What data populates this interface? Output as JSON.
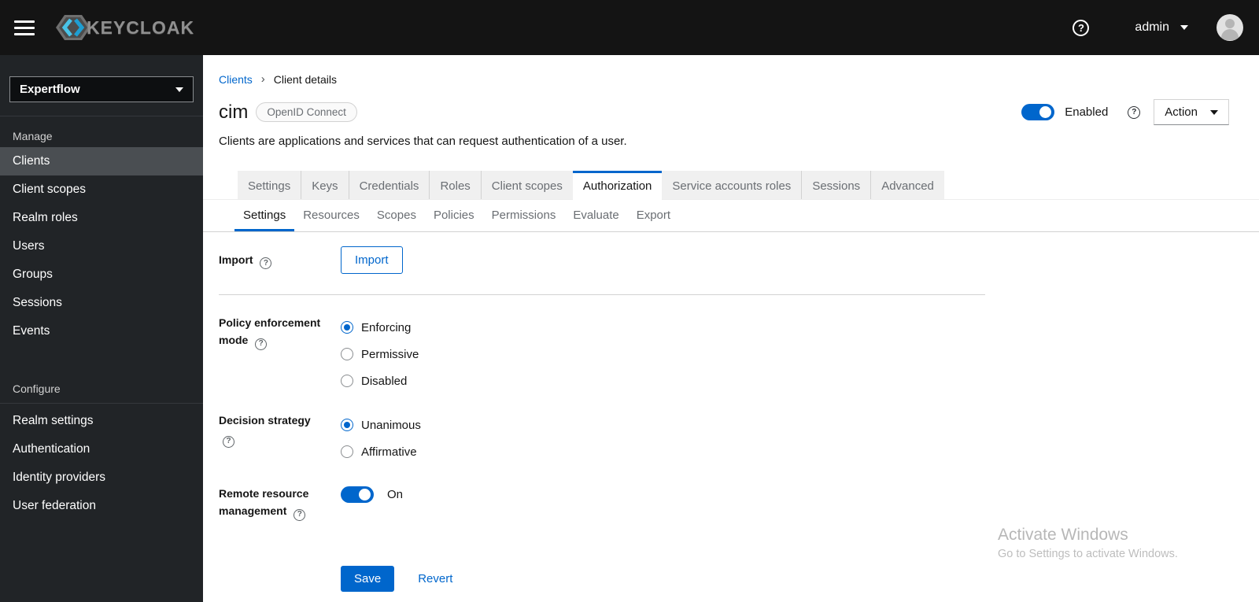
{
  "masthead": {
    "brand": "KEYCLOAK",
    "username": "admin"
  },
  "icons": {
    "help": "?",
    "breadcrumb_separator": "›"
  },
  "sidebar": {
    "realm_selector": {
      "value": "Expertflow"
    },
    "groups": [
      {
        "title": "Manage",
        "items": [
          {
            "label": "Clients",
            "active": true
          },
          {
            "label": "Client scopes",
            "active": false
          },
          {
            "label": "Realm roles",
            "active": false
          },
          {
            "label": "Users",
            "active": false
          },
          {
            "label": "Groups",
            "active": false
          },
          {
            "label": "Sessions",
            "active": false
          },
          {
            "label": "Events",
            "active": false
          }
        ]
      },
      {
        "title": "Configure",
        "items": [
          {
            "label": "Realm settings",
            "active": false
          },
          {
            "label": "Authentication",
            "active": false
          },
          {
            "label": "Identity providers",
            "active": false
          },
          {
            "label": "User federation",
            "active": false
          }
        ]
      }
    ]
  },
  "header": {
    "breadcrumb": [
      "Clients",
      "Client details"
    ],
    "title": "cim",
    "badge": "OpenID Connect",
    "description": "Clients are applications and services that can request authentication of a user.",
    "enabled_label": "Enabled",
    "action_label": "Action"
  },
  "tabs": {
    "items": [
      "Settings",
      "Keys",
      "Credentials",
      "Roles",
      "Client scopes",
      "Authorization",
      "Service accounts roles",
      "Sessions",
      "Advanced"
    ],
    "active": "Authorization"
  },
  "subtabs": {
    "items": [
      "Settings",
      "Resources",
      "Scopes",
      "Policies",
      "Permissions",
      "Evaluate",
      "Export"
    ],
    "active": "Settings"
  },
  "form": {
    "import": {
      "label": "Import",
      "button_label": "Import"
    },
    "policy_enforcement_mode": {
      "label_line1": "Policy enforcement",
      "label_line2": "mode",
      "options": [
        "Enforcing",
        "Permissive",
        "Disabled"
      ],
      "selected": "Enforcing"
    },
    "decision_strategy": {
      "label": "Decision strategy",
      "options": [
        "Unanimous",
        "Affirmative"
      ],
      "selected": "Unanimous"
    },
    "remote_resource_management": {
      "label_line1": "Remote resource",
      "label_line2": "management",
      "state_label": "On",
      "enabled": true
    },
    "save_label": "Save",
    "revert_label": "Revert"
  },
  "watermark": {
    "line1": "Activate Windows",
    "line2": "Go to Settings to activate Windows."
  },
  "colors": {
    "primary": "#0066cc",
    "masthead_bg": "#141414",
    "sidebar_bg": "#212427",
    "sidebar_active_bg": "#4a4e52",
    "tab_inactive_bg": "#f0f0f0",
    "text_dark": "#151515",
    "text_gray": "#6a6e73"
  }
}
